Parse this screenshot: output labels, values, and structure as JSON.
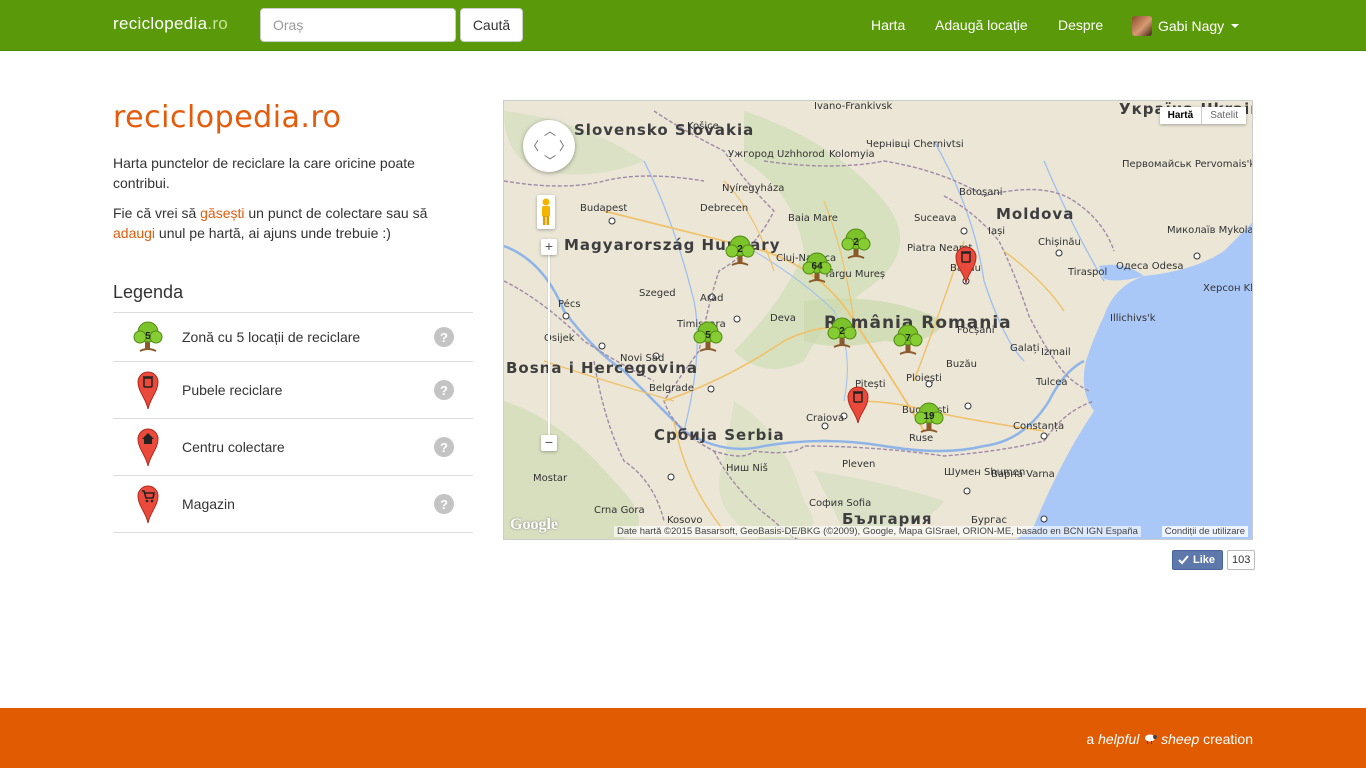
{
  "nav": {
    "brand_name": "reciclopedia",
    "brand_tld": ".ro",
    "search_placeholder": "Oraș",
    "search_button": "Caută",
    "links": [
      "Harta",
      "Adaugă locație",
      "Despre"
    ],
    "user_name": "Gabi Nagy"
  },
  "page": {
    "title": "reciclopedia.ro",
    "intro": "Harta punctelor de reciclare la care oricine poate contribui.",
    "intro2_pre": "Fie că vrei să ",
    "intro2_link1": "găsești",
    "intro2_mid": " un punct de colectare sau să ",
    "intro2_link2": "adaugi",
    "intro2_post": " unul pe hartă, ai ajuns unde trebuie :)"
  },
  "legend": {
    "title": "Legenda",
    "items": [
      {
        "label": "Zonă cu 5 locații de reciclare",
        "icon": "tree-cluster-icon",
        "count": "5"
      },
      {
        "label": "Pubele reciclare",
        "icon": "recycle-bin-pin-icon"
      },
      {
        "label": "Centru colectare",
        "icon": "house-pin-icon"
      },
      {
        "label": "Magazin",
        "icon": "cart-pin-icon"
      }
    ],
    "help": "?"
  },
  "map": {
    "type_active": "Hartă",
    "type_inactive": "Satelit",
    "attribution": "Date hartă ©2015 Basarsoft, GeoBasis-DE/BKG (©2009), Google, Mapa GISrael, ORION-ME, basado en BCN IGN España",
    "terms": "Condiții de utilizare",
    "logo": "Google",
    "clusters": [
      "2",
      "64",
      "2",
      "5",
      "2",
      "7",
      "19"
    ],
    "countries": [
      "Україна Ukraine",
      "Slovensko Slovakia",
      "Magyarország Hungary",
      "Moldova",
      "România Romania",
      "Bosna i Hercegovina",
      "Србија Serbia",
      "България"
    ],
    "cities": [
      "Ivano-Frankivsk",
      "Košice",
      "Ужгород Uzhhorod",
      "Чернівці Chernivtsi",
      "Kolomyia",
      "Nyíregyháza",
      "Budapest",
      "Debrecen",
      "Baia Mare",
      "Suceava",
      "Botoșani",
      "Cluj-Napoca",
      "Târgu Mureș",
      "Piatra Neamț",
      "Iași",
      "Chișinău",
      "Bacău",
      "Szeged",
      "Arad",
      "Pécs",
      "Osijek",
      "Timișoara",
      "Deva",
      "Focșani",
      "Galați",
      "Novi Sad",
      "Belgrade",
      "Pitești",
      "Ploiești",
      "Buzău",
      "Craiova",
      "București",
      "Constanța",
      "Tulcea",
      "Ruse",
      "Pleven",
      "Варна Varna",
      "Шумен Shumen",
      "Ниш Niš",
      "София Sofia",
      "Mostar",
      "Crna Gora",
      "Kosovo",
      "Одеса Odesa",
      "Миколаїв Mykolaiv",
      "Херсон Kherson",
      "Первомайськ Pervomais'k",
      "Tiraspol",
      "Izmail",
      "Illichivs'k",
      "Бургас"
    ]
  },
  "social": {
    "like_label": "Like",
    "like_count": "103"
  },
  "footer": {
    "pre": "a ",
    "helpful": "helpful",
    "sheep": "sheep",
    "post": " creation"
  }
}
